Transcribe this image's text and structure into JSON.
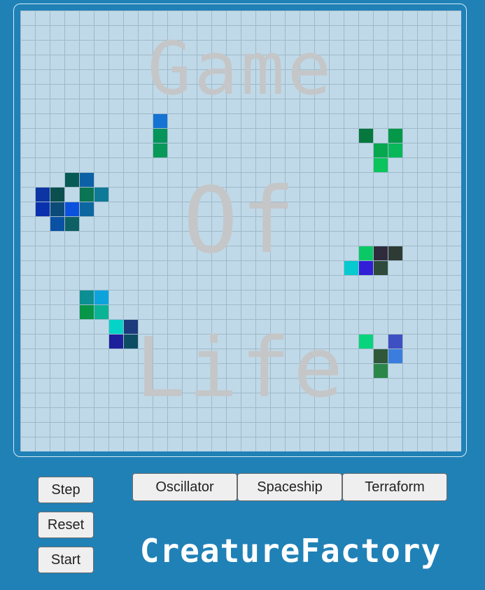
{
  "board": {
    "watermark_lines": [
      "Game",
      "Of",
      "Life"
    ],
    "columns": 30,
    "rows": 30,
    "live_cells": [
      {
        "col": 9,
        "row": 7,
        "color": "#1573d3"
      },
      {
        "col": 9,
        "row": 8,
        "color": "#05945a"
      },
      {
        "col": 9,
        "row": 9,
        "color": "#089859"
      },
      {
        "col": 23,
        "row": 8,
        "color": "#06773d"
      },
      {
        "col": 25,
        "row": 8,
        "color": "#059848"
      },
      {
        "col": 24,
        "row": 9,
        "color": "#07a74f"
      },
      {
        "col": 25,
        "row": 9,
        "color": "#09b75b"
      },
      {
        "col": 24,
        "row": 10,
        "color": "#0ac45c"
      },
      {
        "col": 3,
        "row": 11,
        "color": "#065a55"
      },
      {
        "col": 4,
        "row": 11,
        "color": "#0c61a6"
      },
      {
        "col": 1,
        "row": 12,
        "color": "#0c35a3"
      },
      {
        "col": 2,
        "row": 12,
        "color": "#0a4f4e"
      },
      {
        "col": 4,
        "row": 12,
        "color": "#0a7453"
      },
      {
        "col": 5,
        "row": 12,
        "color": "#0f7a97"
      },
      {
        "col": 1,
        "row": 13,
        "color": "#0a31ad"
      },
      {
        "col": 2,
        "row": 13,
        "color": "#0c4b78"
      },
      {
        "col": 3,
        "row": 13,
        "color": "#0c51de"
      },
      {
        "col": 4,
        "row": 13,
        "color": "#0c67a0"
      },
      {
        "col": 2,
        "row": 14,
        "color": "#0b51a3"
      },
      {
        "col": 3,
        "row": 14,
        "color": "#0d6063"
      },
      {
        "col": 23,
        "row": 16,
        "color": "#0ac865"
      },
      {
        "col": 24,
        "row": 16,
        "color": "#302b3c"
      },
      {
        "col": 25,
        "row": 16,
        "color": "#2e3a34"
      },
      {
        "col": 22,
        "row": 17,
        "color": "#06cacd"
      },
      {
        "col": 23,
        "row": 17,
        "color": "#311ed6"
      },
      {
        "col": 24,
        "row": 17,
        "color": "#2e4a3a"
      },
      {
        "col": 4,
        "row": 19,
        "color": "#0b8f92"
      },
      {
        "col": 5,
        "row": 19,
        "color": "#0ca3dd"
      },
      {
        "col": 4,
        "row": 20,
        "color": "#079547"
      },
      {
        "col": 5,
        "row": 20,
        "color": "#0ab395"
      },
      {
        "col": 6,
        "row": 21,
        "color": "#06d3c8"
      },
      {
        "col": 7,
        "row": 21,
        "color": "#1b3b7c"
      },
      {
        "col": 6,
        "row": 22,
        "color": "#1d1f9b"
      },
      {
        "col": 7,
        "row": 22,
        "color": "#0c4d63"
      },
      {
        "col": 23,
        "row": 22,
        "color": "#07d47c"
      },
      {
        "col": 25,
        "row": 22,
        "color": "#3e4fc2"
      },
      {
        "col": 24,
        "row": 23,
        "color": "#305838"
      },
      {
        "col": 25,
        "row": 23,
        "color": "#3a7ddd"
      },
      {
        "col": 24,
        "row": 24,
        "color": "#2b8749"
      }
    ]
  },
  "controls": {
    "step_label": "Step",
    "reset_label": "Reset",
    "start_label": "Start"
  },
  "presets": {
    "oscillator_label": "Oscillator",
    "spaceship_label": "Spaceship",
    "terraform_label": "Terraform"
  },
  "brand": {
    "title": "CreatureFactory"
  }
}
